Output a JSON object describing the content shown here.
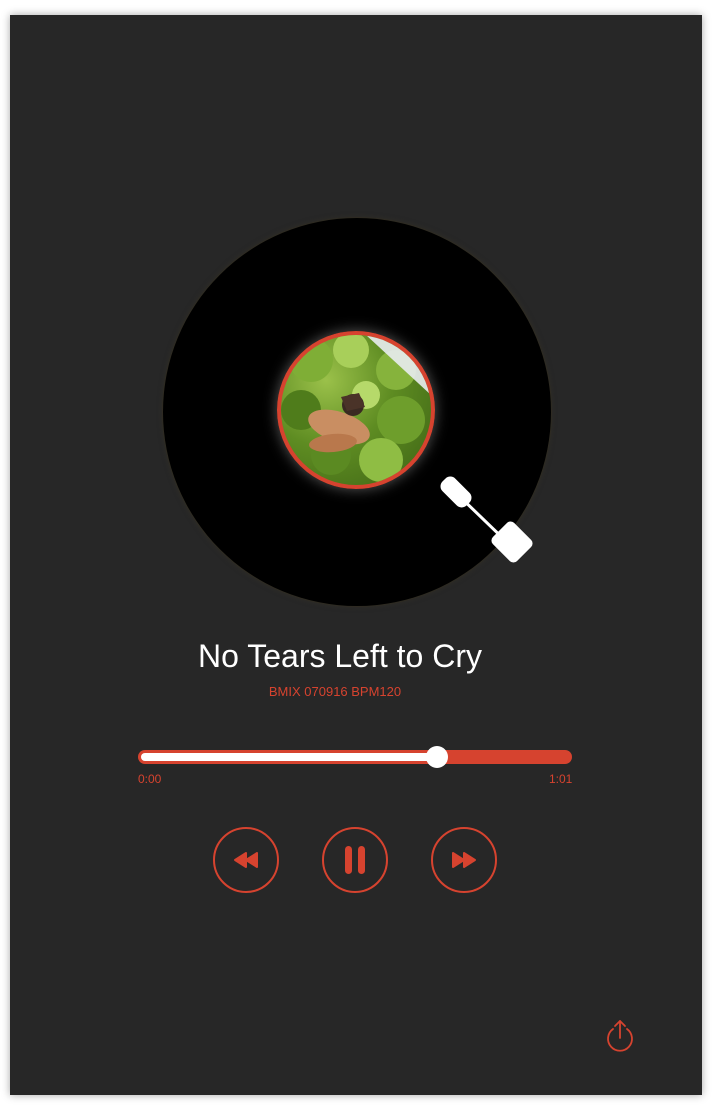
{
  "colors": {
    "background": "#272727",
    "accent": "#d6432f",
    "text": "#ffffff"
  },
  "track": {
    "title": "No Tears Left to Cry",
    "subtitle": "BMIX 070916 BPM120"
  },
  "progress": {
    "current_time": "0:00",
    "total_time": "1:01",
    "fraction": 0.69
  },
  "controls": {
    "rewind_icon": "rewind-icon",
    "pause_icon": "pause-icon",
    "fast_forward_icon": "fast-forward-icon",
    "share_icon": "share-icon"
  }
}
